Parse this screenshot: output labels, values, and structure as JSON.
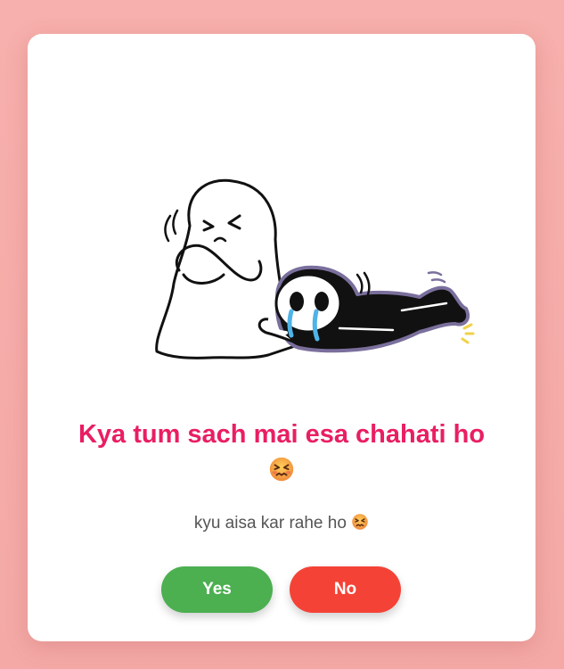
{
  "dialog": {
    "title": "Kya tum sach mai esa chahati ho",
    "title_emoji": "confounded-face-icon",
    "subtitle": "kyu aisa kar rahe ho",
    "subtitle_emoji": "confounded-face-icon",
    "illustration": "crying-skeleton-clinging-to-ghost",
    "yes_label": "Yes",
    "no_label": "No"
  },
  "colors": {
    "background": "#f7b0ad",
    "card": "#ffffff",
    "title": "#e91e63",
    "subtitle": "#555555",
    "yes_button": "#4caf50",
    "no_button": "#f44336"
  }
}
